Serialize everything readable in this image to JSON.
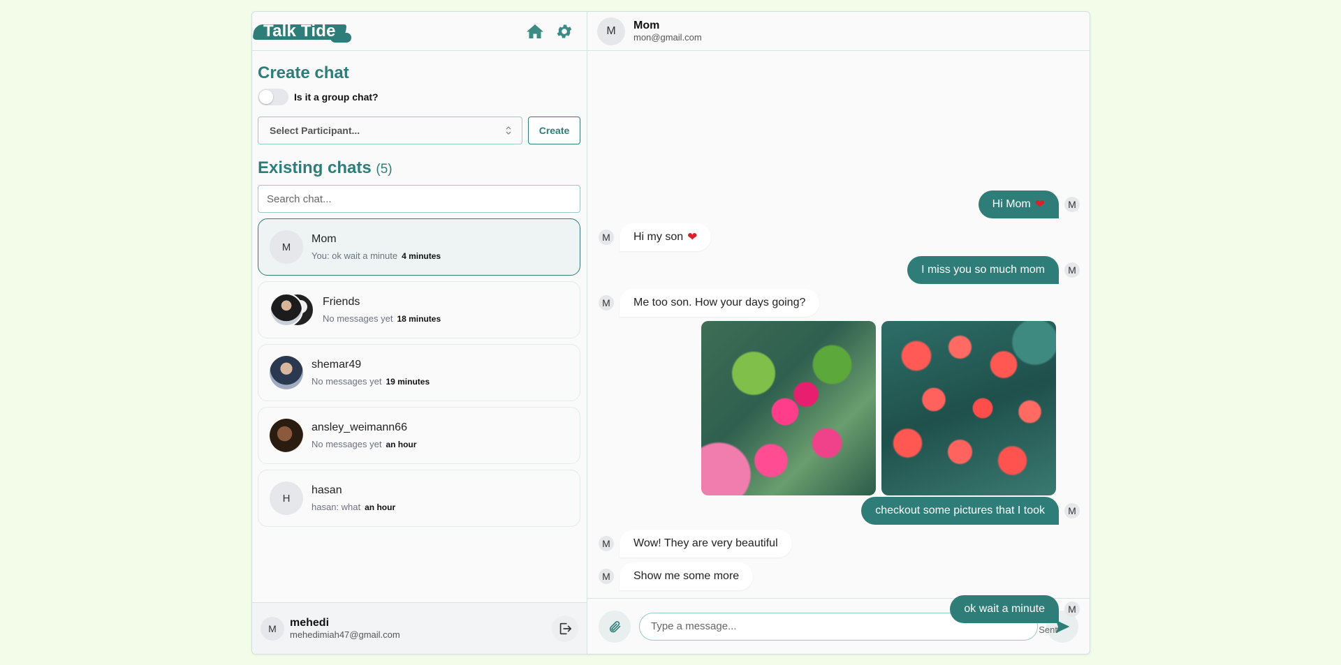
{
  "app": {
    "logo": "Talk Tide"
  },
  "sidebar": {
    "create_title": "Create chat",
    "group_toggle_label": "Is it a group chat?",
    "select_placeholder": "Select Participant...",
    "create_button": "Create",
    "existing_title": "Existing chats",
    "existing_count": "(5)",
    "search_placeholder": "Search chat...",
    "chats": [
      {
        "name": "Mom",
        "initial": "M",
        "preview": "You: ok wait a minute",
        "time": "4 minutes"
      },
      {
        "name": "Friends",
        "initial": "",
        "preview": "No messages yet",
        "time": "18 minutes"
      },
      {
        "name": "shemar49",
        "initial": "",
        "preview": "No messages yet",
        "time": "19 minutes"
      },
      {
        "name": "ansley_weimann66",
        "initial": "",
        "preview": "No messages yet",
        "time": "an hour"
      },
      {
        "name": "hasan",
        "initial": "H",
        "preview": "hasan: what",
        "time": "an hour"
      }
    ],
    "user": {
      "initial": "M",
      "name": "mehedi",
      "email": "mehedimiah47@gmail.com"
    }
  },
  "chat": {
    "contact": {
      "initial": "M",
      "name": "Mom",
      "email": "mon@gmail.com"
    },
    "messages": [
      {
        "text": "Hi Mom",
        "dir": "out",
        "avatar": "M"
      },
      {
        "text": "Hi my son",
        "dir": "in",
        "avatar": "M"
      },
      {
        "text": "I miss you so much mom",
        "dir": "out",
        "avatar": "M"
      },
      {
        "text": "Me too son. How your days going?",
        "dir": "in",
        "avatar": "M"
      },
      {
        "text": "checkout some pictures that I took",
        "dir": "out",
        "avatar": "M"
      },
      {
        "text": "Wow! They are very beautiful",
        "dir": "in",
        "avatar": "M"
      },
      {
        "text": "Show me some more",
        "dir": "in",
        "avatar": "M"
      },
      {
        "text": "ok wait a minute",
        "dir": "out",
        "avatar": "M"
      }
    ],
    "heart_glyph": "❤",
    "sent_status": "Sent",
    "input_placeholder": "Type a message..."
  },
  "colors": {
    "accent": "#2e7d78",
    "background": "#f3fbe9",
    "heart": "#e11d2a"
  },
  "icons": [
    "home-icon",
    "gear-icon",
    "logout-icon",
    "paperclip-icon",
    "send-icon",
    "chevron-updown-icon"
  ]
}
